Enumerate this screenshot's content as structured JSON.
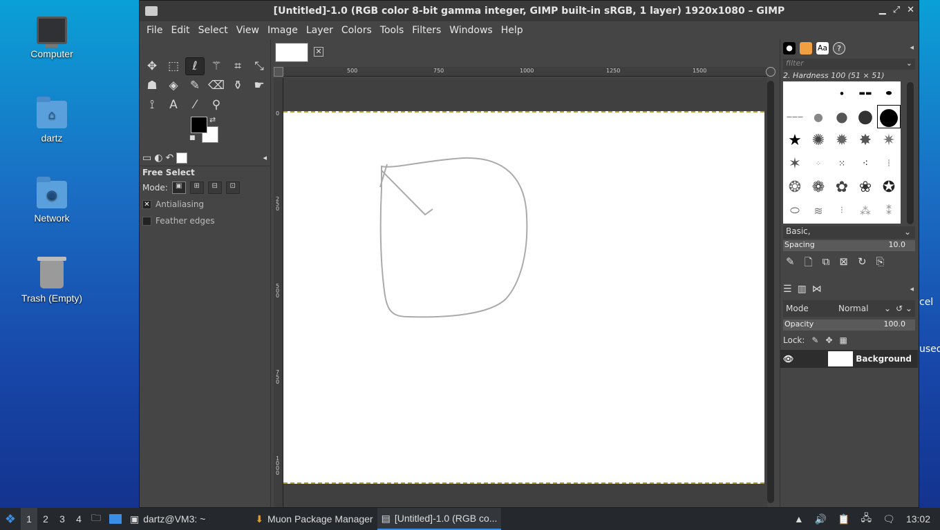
{
  "desktop": {
    "icons": [
      {
        "label": "Computer"
      },
      {
        "label": "dartz"
      },
      {
        "label": "Network"
      },
      {
        "label": "Trash (Empty)"
      }
    ]
  },
  "window": {
    "title": "[Untitled]-1.0 (RGB color 8-bit gamma integer, GIMP built-in sRGB, 1 layer) 1920x1080 – GIMP",
    "menu": [
      "File",
      "Edit",
      "Select",
      "View",
      "Image",
      "Layer",
      "Colors",
      "Tools",
      "Filters",
      "Windows",
      "Help"
    ]
  },
  "toolbox": {
    "tools": [
      "move-icon",
      "rect-select-icon",
      "lasso-icon",
      "fuzzy-select-icon",
      "crop-icon",
      "transform-icon",
      "warp-icon",
      "bucket-fill-icon",
      "paintbrush-icon",
      "eraser-icon",
      "clone-icon",
      "smudge-icon",
      "paths-icon",
      "text-icon",
      "color-picker-icon",
      "zoom-icon"
    ],
    "active_tool": "lasso-icon",
    "options": {
      "title": "Free Select",
      "mode_label": "Mode:",
      "antialiasing": "Antialiasing",
      "feather": "Feather edges"
    }
  },
  "canvas": {
    "ruler_h": [
      "500",
      "750",
      "1000",
      "1250",
      "1500"
    ],
    "ruler_v": [
      "0",
      "250",
      "500",
      "750",
      "1000"
    ]
  },
  "brushes": {
    "filter_placeholder": "filter",
    "selected": "2. Hardness 100 (51 × 51)",
    "tag": "Basic,",
    "spacing_label": "Spacing",
    "spacing_value": "10.0"
  },
  "layers": {
    "mode_label": "Mode",
    "mode_value": "Normal",
    "opacity_label": "Opacity",
    "opacity_value": "100.0",
    "lock_label": "Lock:",
    "layer_name": "Background"
  },
  "peek": {
    "line1": "cel",
    "line2": "used"
  },
  "taskbar": {
    "workspaces": [
      "1",
      "2",
      "3",
      "4"
    ],
    "tasks": [
      "dartz@VM3: ~",
      "Muon Package Manager",
      "[Untitled]-1.0 (RGB co..."
    ],
    "clock": "13:02"
  }
}
